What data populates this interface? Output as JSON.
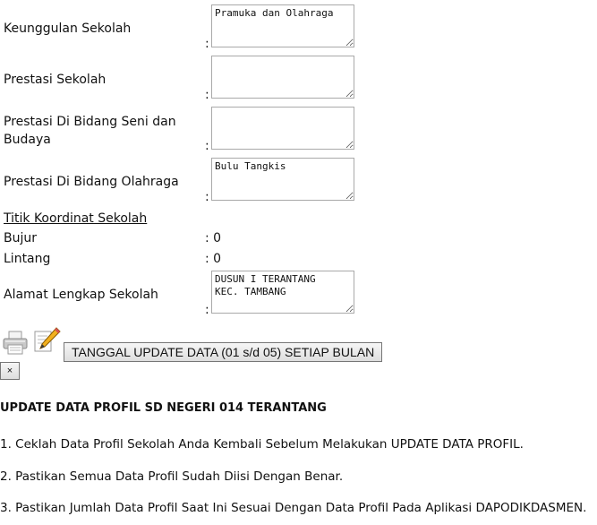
{
  "form": {
    "fields": [
      {
        "label": "Keunggulan Sekolah",
        "value": "Pramuka dan Olahraga"
      },
      {
        "label": "Prestasi Sekolah",
        "value": ""
      },
      {
        "label": "Prestasi Di Bidang Seni dan Budaya",
        "value": ""
      },
      {
        "label": "Prestasi Di Bidang Olahraga",
        "value": "Bulu Tangkis"
      }
    ],
    "colon": ":",
    "coordinates": {
      "title": "Titik Koordinat Sekolah",
      "bujur_label": "Bujur",
      "bujur_value": ": 0",
      "lintang_label": "Lintang",
      "lintang_value": ": 0"
    },
    "address": {
      "label": "Alamat Lengkap Sekolah",
      "value": "DUSUN I TERANTANG\nKEC. TAMBANG"
    }
  },
  "toolbar": {
    "update_button": "TANGGAL UPDATE DATA (01 s/d 05) SETIAP BULAN",
    "close_button": "×",
    "print_icon": "printer-icon",
    "edit_icon": "pencil-icon"
  },
  "notice": {
    "heading": "UPDATE DATA PROFIL SD NEGERI 014 TERANTANG",
    "items": [
      "1. Ceklah Data Profil Sekolah Anda Kembali Sebelum Melakukan UPDATE DATA PROFIL.",
      "2. Pastikan Semua Data Profil Sudah Diisi Dengan Benar.",
      "3. Pastikan Jumlah Data Profil Saat Ini Sesuai Dengan Data Profil Pada Aplikasi DAPODIKDASMEN."
    ]
  }
}
